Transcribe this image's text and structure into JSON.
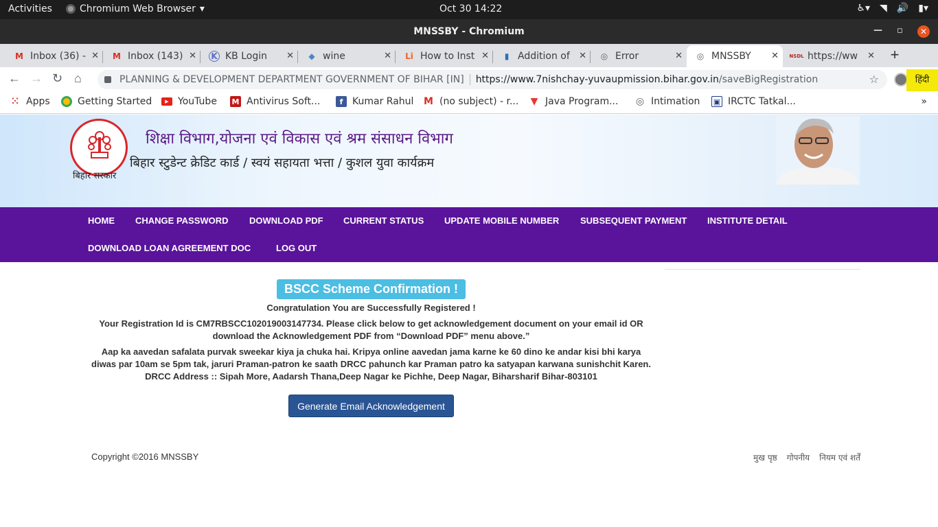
{
  "os_topbar": {
    "activities": "Activities",
    "app_name": "Chromium Web Browser",
    "clock": "Oct 30  14:22"
  },
  "window": {
    "title": "MNSSBY - Chromium"
  },
  "tabs": [
    {
      "label": "Inbox (36) -",
      "icon": "gmail-icon"
    },
    {
      "label": "Inbox (143)",
      "icon": "gmail-icon"
    },
    {
      "label": "KB Login",
      "icon": "kb-icon"
    },
    {
      "label": "wine",
      "icon": "wine-icon"
    },
    {
      "label": "How to Inst",
      "icon": "li-icon"
    },
    {
      "label": "Addition of",
      "icon": "doc-icon"
    },
    {
      "label": "Error",
      "icon": "globe-icon"
    },
    {
      "label": "MNSSBY",
      "icon": "globe-icon",
      "active": true
    },
    {
      "label": "https://ww",
      "icon": "nsdl-icon"
    }
  ],
  "omnibox": {
    "org": "PLANNING & DEVELOPMENT DEPARTMENT GOVERNMENT OF BIHAR [IN]",
    "url_host": "https://www.7nishchay-yuvaupmission.bihar.gov.in",
    "url_path": "/saveBigRegistration"
  },
  "bookmarks": [
    {
      "label": "Apps",
      "icon": "apps-grid-icon"
    },
    {
      "label": "Getting Started",
      "icon": "chrome-icon"
    },
    {
      "label": "YouTube",
      "icon": "youtube-icon"
    },
    {
      "label": "Antivirus Soft...",
      "icon": "mcafee-icon"
    },
    {
      "label": "Kumar Rahul",
      "icon": "facebook-icon"
    },
    {
      "label": "(no subject) - r...",
      "icon": "gmail-icon"
    },
    {
      "label": "Java Program...",
      "icon": "tutorials-icon"
    },
    {
      "label": "Intimation",
      "icon": "globe-icon"
    },
    {
      "label": "IRCTC Tatkal...",
      "icon": "irctc-icon"
    }
  ],
  "header": {
    "title": "शिक्षा विभाग,योजना एवं विकास एवं श्रम संसाधन विभाग",
    "subtitle": "बिहार स्टुडेन्ट क्रेडिट कार्ड / स्वयं सहायता भत्ता / कुशल युवा कार्यक्रम",
    "emblem_caption": "बिहार सरकार",
    "lang_button": "हिंदी"
  },
  "nav": [
    "HOME",
    "CHANGE PASSWORD",
    "DOWNLOAD PDF",
    "CURRENT STATUS",
    "UPDATE MOBILE NUMBER",
    "SUBSEQUENT PAYMENT",
    "INSTITUTE DETAIL",
    "DOWNLOAD LOAN AGREEMENT DOC",
    "LOG OUT"
  ],
  "confirmation": {
    "badge": "BSCC Scheme Confirmation !",
    "line1": "Congratulation You are Successfully Registered !",
    "line2a": "Your Registration Id is CM7RBSCC102019003147734. Please click below to get acknowledgement document on your email id OR",
    "line2b": "download the Acknowledgement PDF from “Download PDF” menu above.”",
    "line3a": "Aap ka aavedan safalata purvak sweekar kiya ja chuka hai. Kripya online aavedan jama karne ke 60 dino ke andar kisi bhi karya",
    "line3b": "diwas par 10am se 5pm tak, jaruri Praman-patron ke saath DRCC pahunch kar Praman patro ka satyapan karwana sunishchit Karen.",
    "line3c": "DRCC Address :: Sipah More, Aadarsh Thana,Deep Nagar ke Pichhe, Deep Nagar, Biharsharif Bihar-803101",
    "button": "Generate Email Acknowledgement"
  },
  "footer": {
    "copyright": "Copyright ©2016 MNSSBY",
    "links": [
      "मुख पृष्ठ",
      "गोपनीय",
      "नियम एवं शर्तें"
    ]
  },
  "colors": {
    "nav_bg": "#5a139b",
    "badge_bg": "#4cbde3",
    "button_bg": "#2a5595",
    "lang_button_bg": "#f5e90a",
    "header_title": "#5a1a86"
  }
}
